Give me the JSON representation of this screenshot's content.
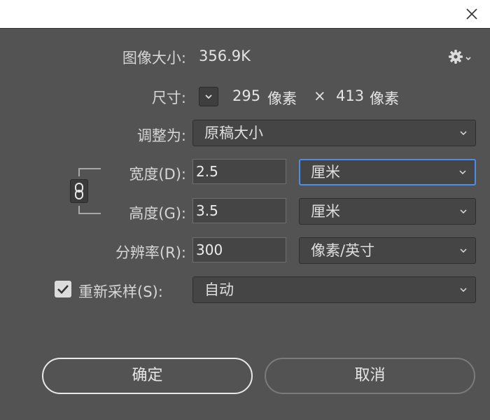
{
  "dialog": {
    "image_size_label": "图像大小:",
    "image_size_value": "356.9K",
    "dimensions_label": "尺寸:",
    "dim_width": "295",
    "dim_unit_1": "像素",
    "dim_times": "×",
    "dim_height": "413",
    "dim_unit_2": "像素",
    "fit_to_label": "调整为:",
    "fit_to_value": "原稿大小",
    "width_label": "宽度(D):",
    "width_value": "2.5",
    "width_unit": "厘米",
    "height_label": "高度(G):",
    "height_value": "3.5",
    "height_unit": "厘米",
    "resolution_label": "分辨率(R):",
    "resolution_value": "300",
    "resolution_unit": "像素/英寸",
    "resample_label": "重新采样(S):",
    "resample_checked": true,
    "resample_value": "自动",
    "ok_label": "确定",
    "cancel_label": "取消"
  },
  "colors": {
    "background": "#535353",
    "field": "#454545",
    "focus": "#4a8ee8",
    "text": "#dedede"
  },
  "icons": [
    "close-icon",
    "gear-icon",
    "chevron-down-icon",
    "link-icon",
    "check-icon"
  ]
}
